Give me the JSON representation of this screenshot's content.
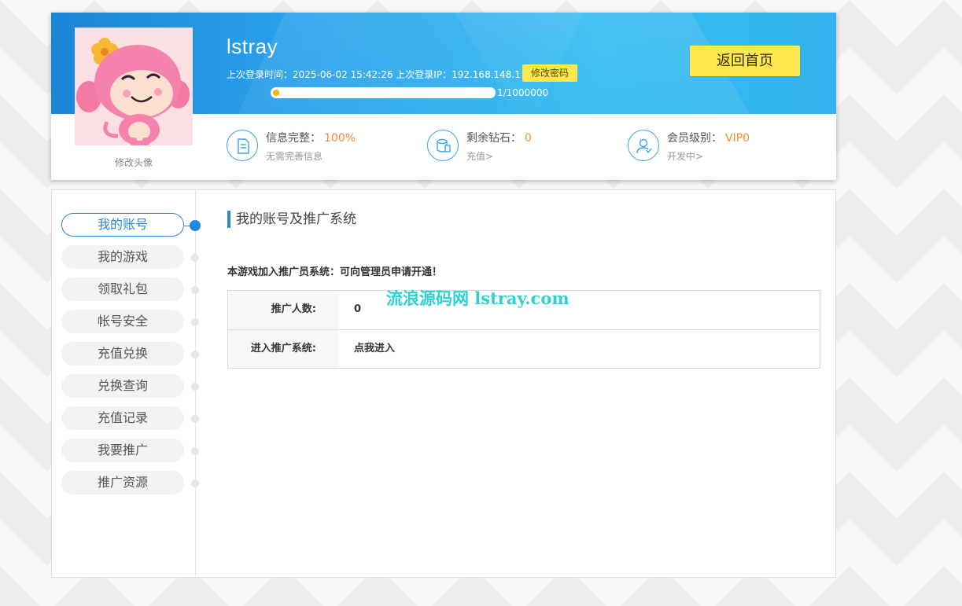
{
  "header": {
    "username": "lstray",
    "last_login_label": "上次登录时间：",
    "last_login_time": "2025-06-02 15:42:26",
    "last_ip_label": "上次登录IP：",
    "last_ip": "192.168.148.1",
    "change_password_label": "修改密码",
    "progress_text": "1/1000000",
    "progress_fraction": 1e-06,
    "home_button_label": "返回首页",
    "change_avatar_label": "修改头像"
  },
  "stats": [
    {
      "icon": "document-icon",
      "label": "信息完整：",
      "value": "100%",
      "sub": "无需完善信息"
    },
    {
      "icon": "database-icon",
      "label": "剩余钻石：",
      "value": "0",
      "sub": "充值>"
    },
    {
      "icon": "user-icon",
      "label": "会员级别：",
      "value": "VIP0",
      "sub": "开发中>"
    }
  ],
  "sidebar": {
    "items": [
      {
        "label": "我的账号",
        "active": true
      },
      {
        "label": "我的游戏"
      },
      {
        "label": "领取礼包"
      },
      {
        "label": "帐号安全"
      },
      {
        "label": "充值兑换"
      },
      {
        "label": "兑换查询"
      },
      {
        "label": "充值记录"
      },
      {
        "label": "我要推广"
      },
      {
        "label": "推广资源"
      }
    ]
  },
  "main": {
    "title": "我的账号及推广系统",
    "notice": "本游戏加入推广员系统：可向管理员申请开通！",
    "watermark": "流浪源码网 lstray.com",
    "rows": [
      {
        "label": "推广人数:",
        "value": "0"
      },
      {
        "label": "进入推广系统:",
        "value": "点我进入"
      }
    ]
  },
  "colors": {
    "accent": "#2b86d6",
    "header_gradient_start": "#1a86d6",
    "header_gradient_end": "#37bdf2",
    "button_yellow": "#ffe84d",
    "stat_value_orange": "#f0892e",
    "watermark": "#2ad2d0"
  }
}
